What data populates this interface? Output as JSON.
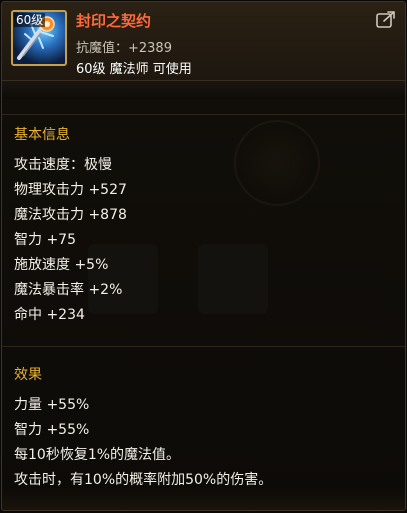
{
  "item": {
    "level_badge": "60级",
    "name": "封印之契约",
    "resistance": "抗魔值：+2389",
    "requirement": "60级 魔法师 可使用"
  },
  "basic_info": {
    "title": "基本信息",
    "stats": [
      "攻击速度：极慢",
      "物理攻击力 +527",
      "魔法攻击力 +878",
      "智力 +75",
      "施放速度 +5%",
      "魔法暴击率 +2%",
      "命中 +234"
    ]
  },
  "effects": {
    "title": "效果",
    "lines": [
      "力量 +55%",
      "智力 +55%",
      "每10秒恢复1%的魔法值。",
      "攻击时，有10%的概率附加50%的伤害。"
    ]
  },
  "colors": {
    "name": "#ff6a3c",
    "section_title": "#e8b22e",
    "text": "#f2efe6",
    "frame": "#c9a04a"
  },
  "icons": {
    "item": "wand-icon",
    "share": "share-icon"
  }
}
